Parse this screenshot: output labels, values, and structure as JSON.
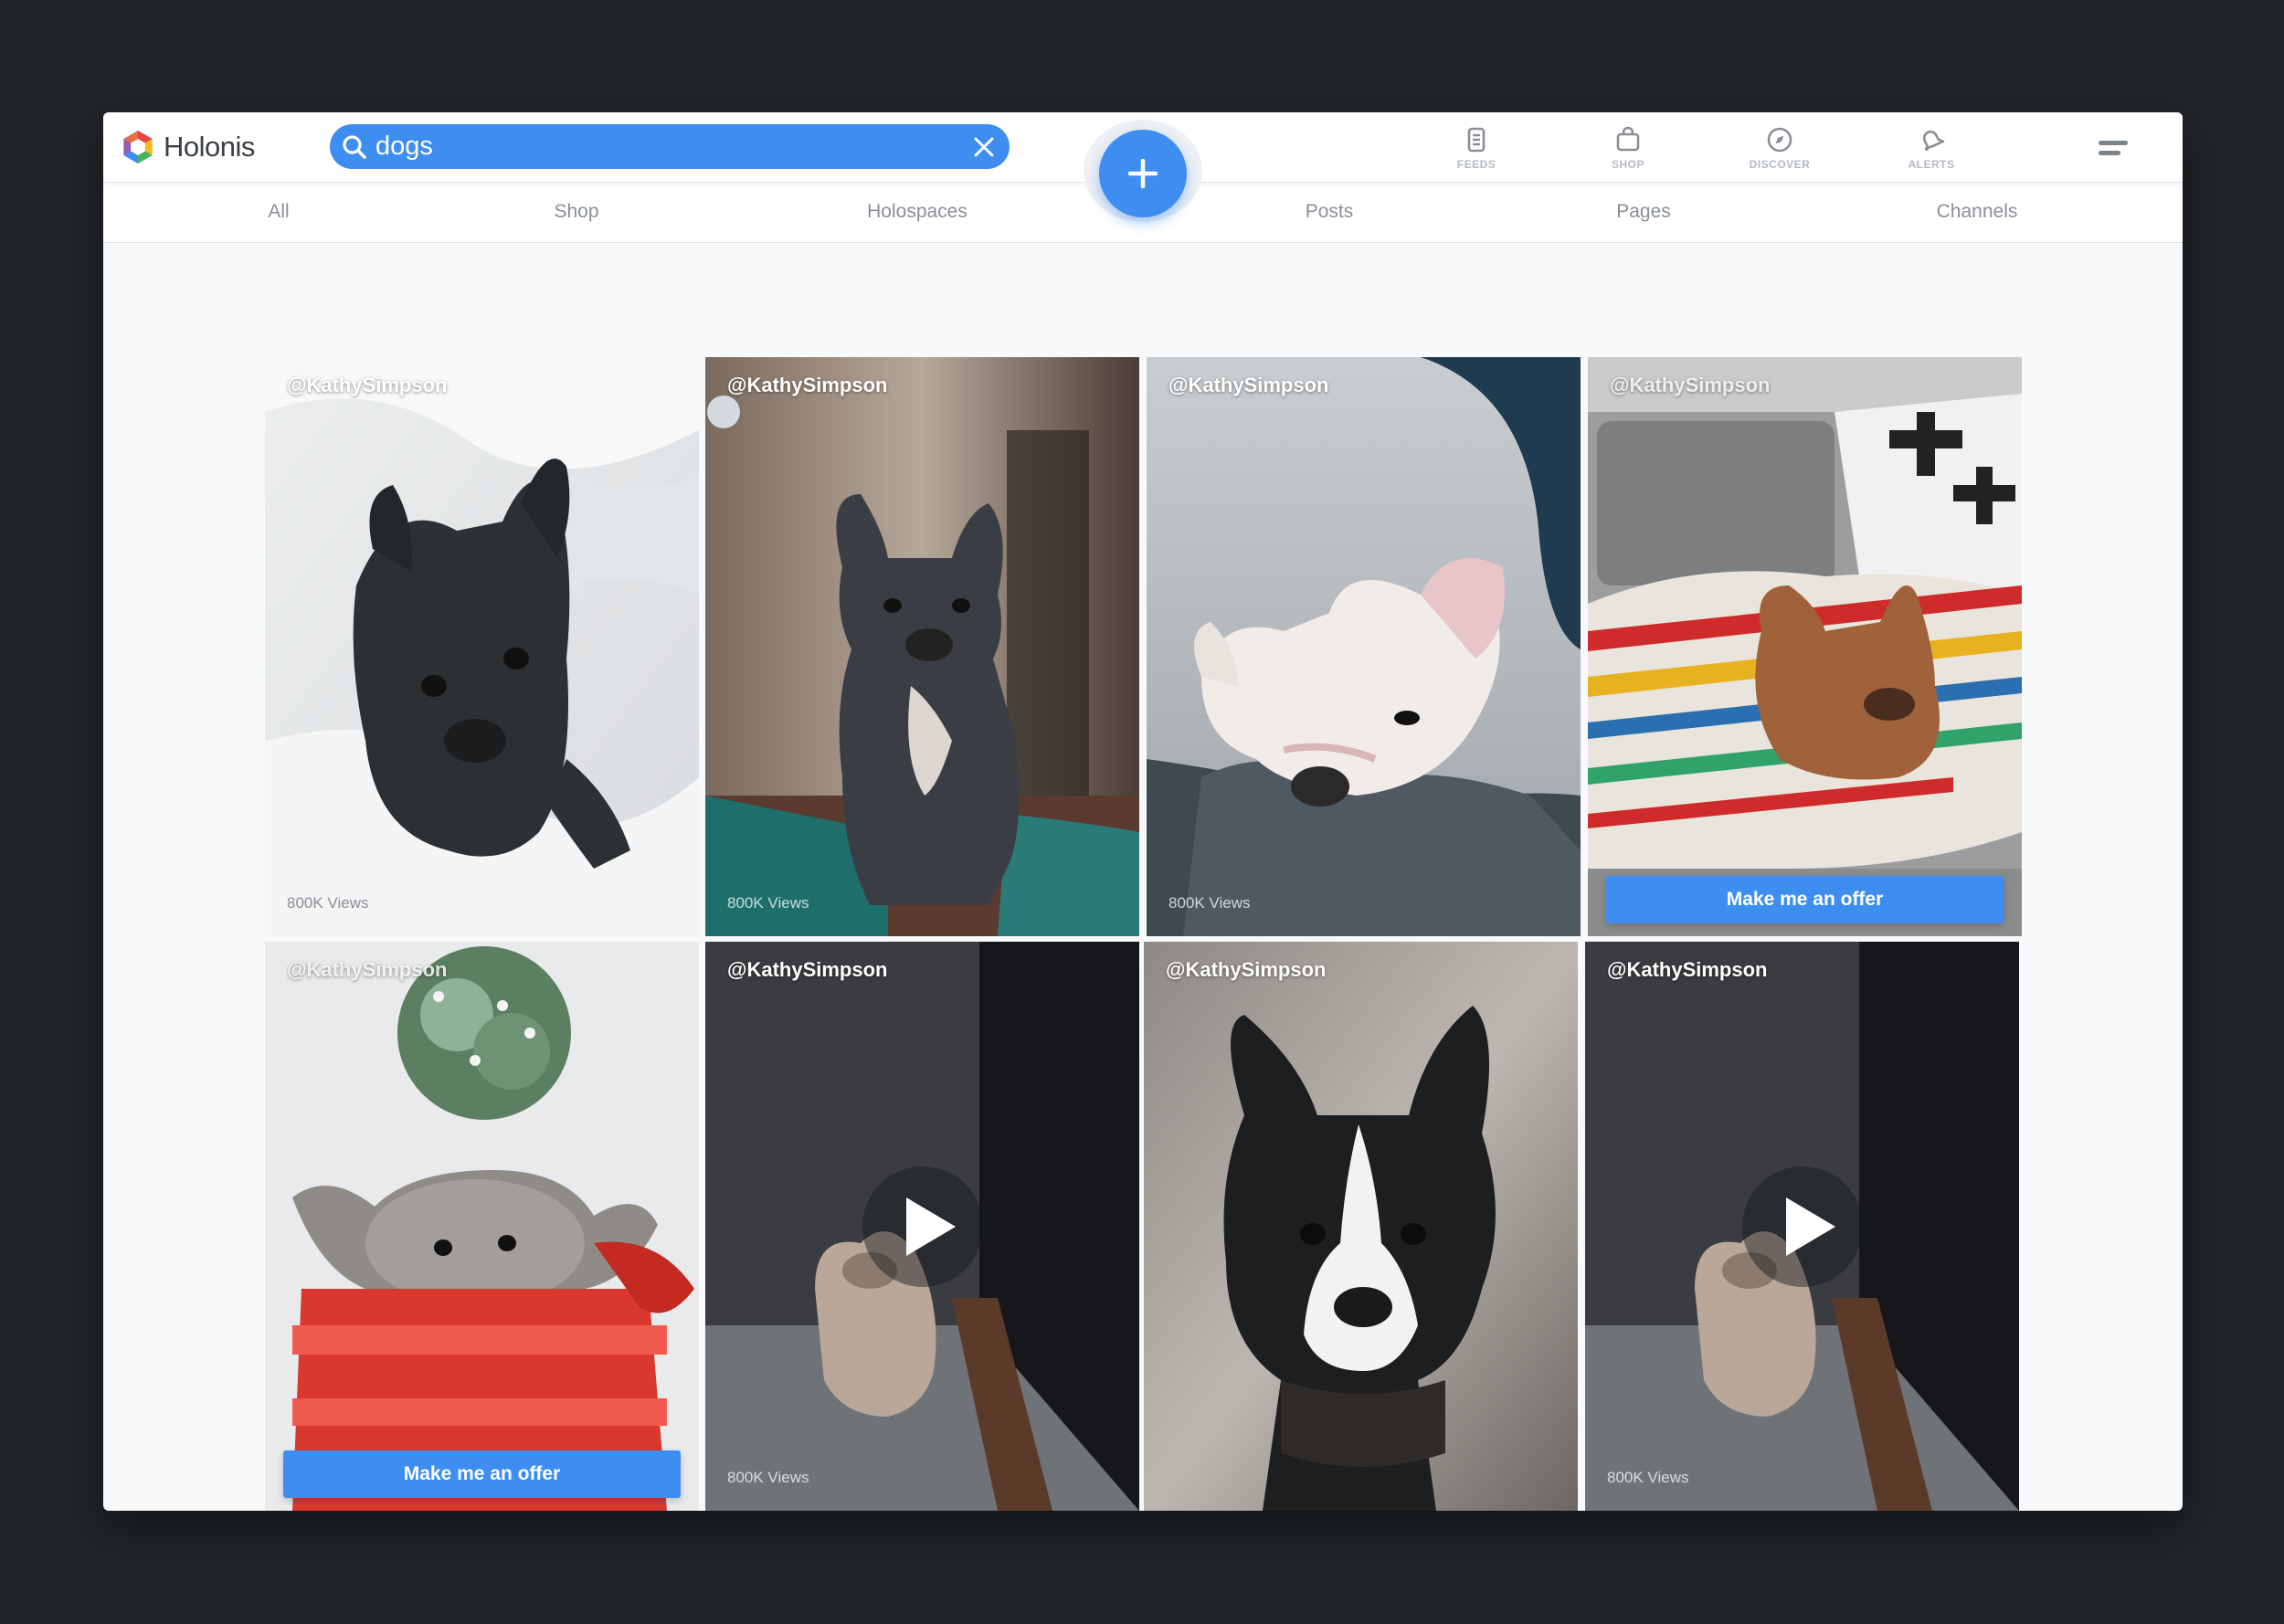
{
  "app": {
    "name": "Holonis",
    "logo_colors": [
      "#e8453c",
      "#f6b81c",
      "#46b35f",
      "#3d8ef0",
      "#9b59b6"
    ]
  },
  "search": {
    "value": "dogs",
    "placeholder": "Search",
    "accent": "#3d8ef0"
  },
  "nav": [
    {
      "label": "FEEDS",
      "icon": "feeds-icon"
    },
    {
      "label": "SHOP",
      "icon": "shop-bag-icon"
    },
    {
      "label": "DISCOVER",
      "icon": "compass-icon"
    },
    {
      "label": "ALERTS",
      "icon": "bell-icon"
    }
  ],
  "tabs": [
    "All",
    "Shop",
    "Holospaces",
    "Posts",
    "Pages",
    "Channels"
  ],
  "tiles": [
    {
      "user": "@KathySimpson",
      "views": "800K Views",
      "offer": "",
      "video": false,
      "scene": "dark french bulldog on white duvet"
    },
    {
      "user": "@KathySimpson",
      "views": "800K Views",
      "offer": "",
      "video": false,
      "scene": "grey french bulldog sitting"
    },
    {
      "user": "@KathySimpson",
      "views": "800K Views",
      "offer": "",
      "video": false,
      "scene": "white bulldog on grey blanket"
    },
    {
      "user": "@KathySimpson",
      "views": "",
      "offer": "Make me an offer",
      "video": false,
      "scene": "fawn bulldog on striped blanket"
    },
    {
      "user": "@KathySimpson",
      "views": "",
      "offer": "Make me an offer",
      "video": false,
      "scene": "puppy in red gift box"
    },
    {
      "user": "@KathySimpson",
      "views": "800K Views",
      "offer": "",
      "video": true,
      "scene": "bulldog on dark porch"
    },
    {
      "user": "@KathySimpson",
      "views": "",
      "offer": "",
      "video": false,
      "scene": "boston terrier portrait"
    },
    {
      "user": "@KathySimpson",
      "views": "800K Views",
      "offer": "",
      "video": true,
      "scene": "bulldog on dark porch"
    }
  ]
}
